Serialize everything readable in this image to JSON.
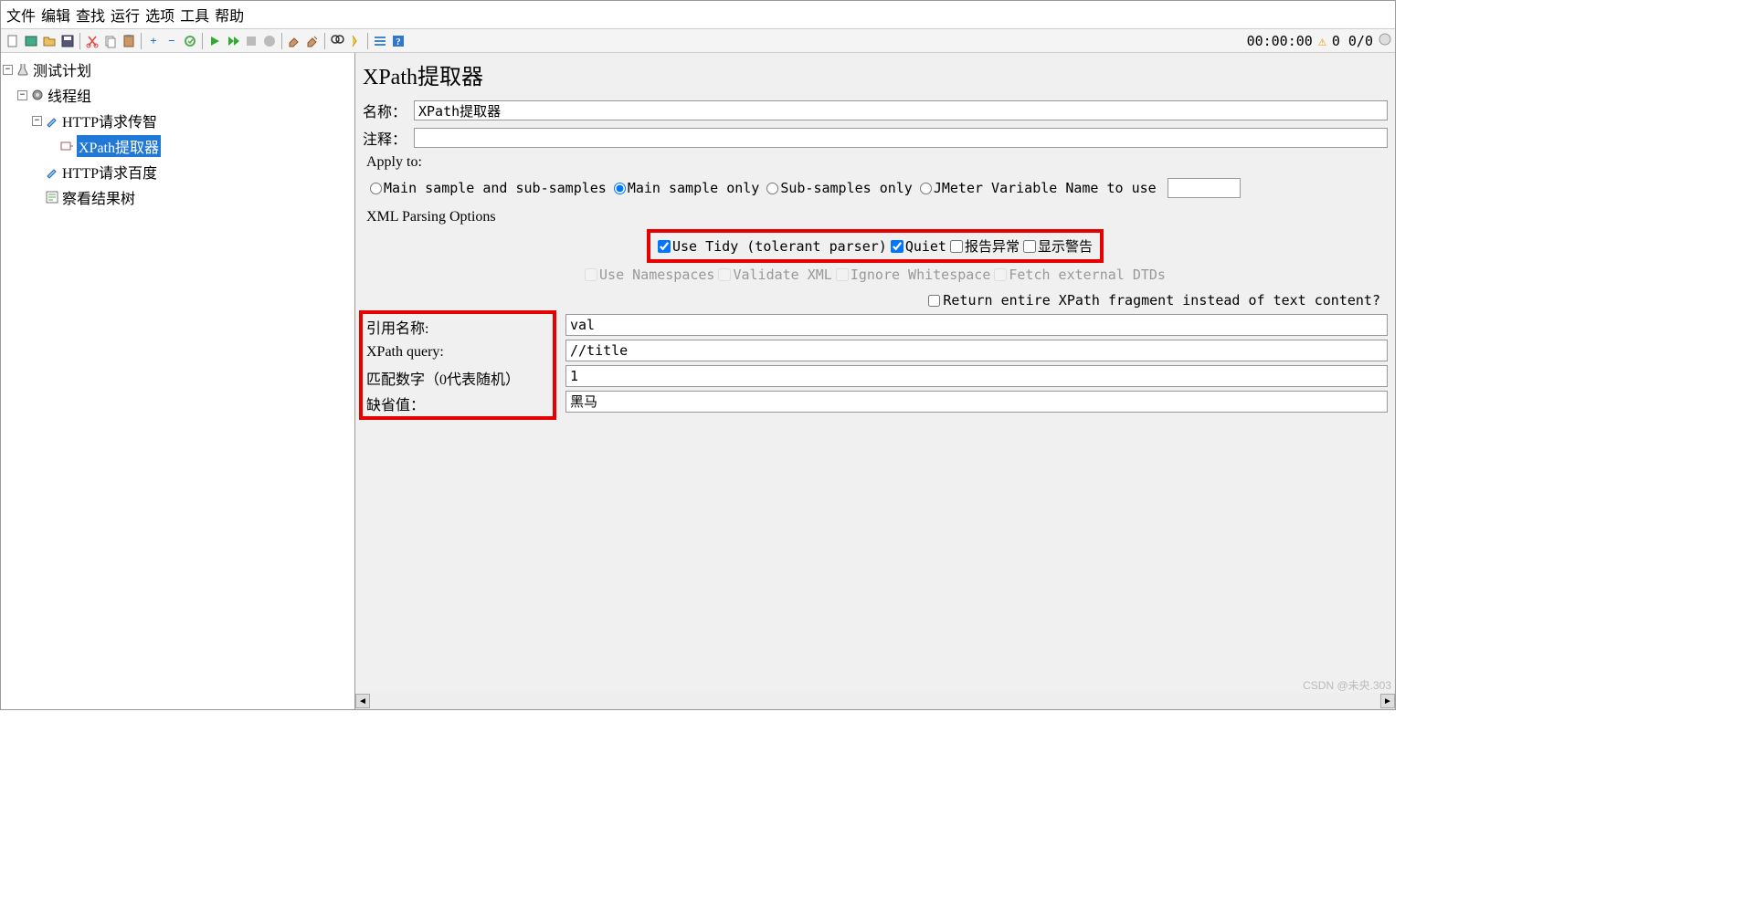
{
  "menu": {
    "file": "文件",
    "edit": "编辑",
    "search": "查找",
    "run": "运行",
    "options": "选项",
    "tools": "工具",
    "help": "帮助"
  },
  "status": {
    "time": "00:00:00",
    "counts": "0 0/0"
  },
  "tree": {
    "root": "测试计划",
    "group": "线程组",
    "http1": "HTTP请求传智",
    "xpath": "XPath提取器",
    "http2": "HTTP请求百度",
    "results": "察看结果树"
  },
  "panel": {
    "title": "XPath提取器",
    "name_label": "名称：",
    "name_value": "XPath提取器",
    "comment_label": "注释：",
    "comment_value": "",
    "apply_label": "Apply to:",
    "radios": {
      "r1": "Main sample and sub-samples",
      "r2": "Main sample only",
      "r3": "Sub-samples only",
      "r4": "JMeter Variable Name to use"
    },
    "xml_label": "XML Parsing Options",
    "xml1": {
      "c1": "Use Tidy (tolerant parser)",
      "c2": "Quiet",
      "c3": "报告异常",
      "c4": "显示警告"
    },
    "xml2": {
      "c1": "Use Namespaces",
      "c2": "Validate XML",
      "c3": "Ignore Whitespace",
      "c4": "Fetch external DTDs"
    },
    "return_label": "Return entire XPath fragment instead of text content?",
    "extract": {
      "ref_label": "引用名称:",
      "ref_value": "val",
      "query_label": "XPath query:",
      "query_value": "//title",
      "match_label": "匹配数字（0代表随机）",
      "match_value": "1",
      "default_label": "缺省值：",
      "default_value": "黑马"
    }
  },
  "watermark": "CSDN @未央.303"
}
